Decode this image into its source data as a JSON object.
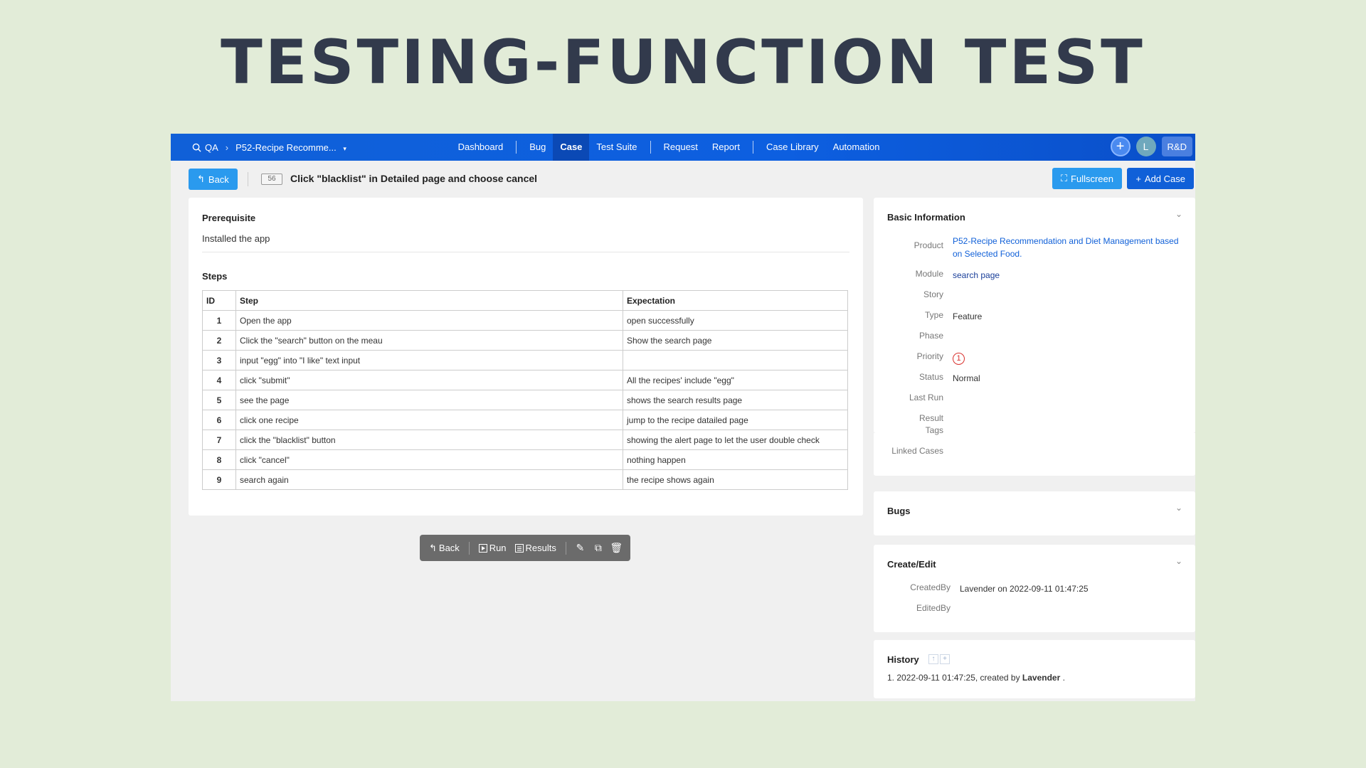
{
  "slide_title": "TESTING-FUNCTION TEST",
  "topnav": {
    "qa_label": "QA",
    "product_crumb": "P52-Recipe Recomme...",
    "items": [
      "Dashboard",
      "Bug",
      "Case",
      "Test Suite",
      "Request",
      "Report",
      "Case Library",
      "Automation"
    ],
    "active": "Case",
    "avatar_letter": "L",
    "rd_label": "R&D"
  },
  "toolbar": {
    "back_label": "Back",
    "case_id": "56",
    "case_title": "Click \"blacklist\" in Detailed page and choose cancel",
    "fullscreen_label": "Fullscreen",
    "add_case_label": "Add Case"
  },
  "main": {
    "prerequisite_title": "Prerequisite",
    "prerequisite_text": "Installed the app",
    "steps_title": "Steps",
    "columns": [
      "ID",
      "Step",
      "Expectation"
    ],
    "steps": [
      {
        "id": "1",
        "step": "Open the app",
        "expect": "open successfully"
      },
      {
        "id": "2",
        "step": "Click the \"search\" button on the meau",
        "expect": "Show the search page"
      },
      {
        "id": "3",
        "step": "input \"egg\" into \"I like\" text input",
        "expect": ""
      },
      {
        "id": "4",
        "step": "click \"submit\"",
        "expect": "All the recipes' include \"egg\""
      },
      {
        "id": "5",
        "step": "see the page",
        "expect": "shows the search results page"
      },
      {
        "id": "6",
        "step": "click one recipe",
        "expect": "jump to the recipe datailed page"
      },
      {
        "id": "7",
        "step": "click the \"blacklist\" button",
        "expect": "showing the alert page to let the user double check"
      },
      {
        "id": "8",
        "step": "click \"cancel\"",
        "expect": "nothing happen"
      },
      {
        "id": "9",
        "step": "search again",
        "expect": "the recipe shows again"
      }
    ]
  },
  "actionbar": {
    "back_label": "Back",
    "run_label": "Run",
    "results_label": "Results"
  },
  "basic_info": {
    "title": "Basic Information",
    "product_label": "Product",
    "product_value": "P52-Recipe Recommendation and Diet Management based on Selected Food.",
    "module_label": "Module",
    "module_value": "search page",
    "story_label": "Story",
    "type_label": "Type",
    "type_value": "Feature",
    "phase_label": "Phase",
    "priority_label": "Priority",
    "priority_value": "1",
    "status_label": "Status",
    "status_value": "Normal",
    "lastrun_label": "Last Run",
    "result_label": "Result",
    "tags_label": "Tags",
    "linked_label": "Linked Cases"
  },
  "bugs": {
    "title": "Bugs"
  },
  "create_edit": {
    "title": "Create/Edit",
    "createdby_label": "CreatedBy",
    "createdby_value": "Lavender on 2022-09-11 01:47:25",
    "editedby_label": "EditedBy"
  },
  "history": {
    "title": "History",
    "entry_prefix": "1. 2022-09-11 01:47:25, created by ",
    "entry_user": "Lavender",
    "entry_suffix": " ."
  },
  "colors": {
    "nav_blue": "#1060d8",
    "button_blue": "#2a9aee",
    "slide_bg": "#e2ecd8",
    "priority_red": "#d9322e"
  },
  "icons": [
    "search-icon",
    "chevron-right-icon",
    "caret-down-icon",
    "plus-icon",
    "back-arrow-icon",
    "fullscreen-icon",
    "play-icon",
    "results-icon",
    "edit-icon",
    "copy-icon",
    "delete-icon",
    "chevron-down-icon"
  ]
}
